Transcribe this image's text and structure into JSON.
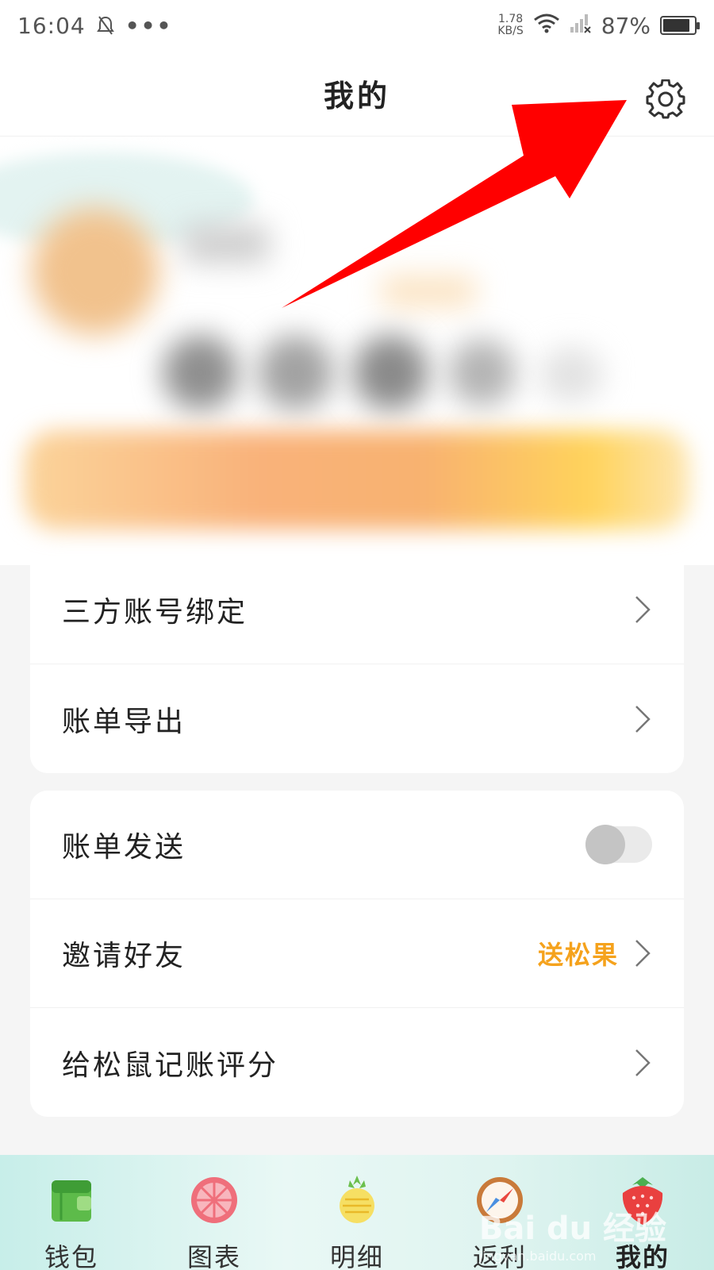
{
  "status_bar": {
    "time": "16:04",
    "dots": "•••",
    "speed_value": "1.78",
    "speed_unit": "KB/S",
    "battery_percent": "87%",
    "battery_level": 0.87
  },
  "header": {
    "title": "我的"
  },
  "menu_card1": {
    "items": [
      {
        "label": "三方账号绑定"
      },
      {
        "label": "账单导出"
      }
    ]
  },
  "menu_card2": {
    "bill_send": {
      "label": "账单发送",
      "toggle_on": false
    },
    "invite": {
      "label": "邀请好友",
      "extra": "送松果"
    },
    "rate": {
      "label": "给松鼠记账评分"
    }
  },
  "tabbar": {
    "tabs": [
      {
        "label": "钱包",
        "icon": "wallet-icon"
      },
      {
        "label": "图表",
        "icon": "chart-icon"
      },
      {
        "label": "明细",
        "icon": "pineapple-icon"
      },
      {
        "label": "返利",
        "icon": "compass-icon"
      },
      {
        "label": "我的",
        "icon": "strawberry-icon",
        "active": true
      }
    ]
  },
  "watermark": {
    "brand": "Bai du 经验",
    "site": "jingyan.baidu.com"
  },
  "colors": {
    "accent": "#f5a21c",
    "arrow": "#ff0000",
    "tabbar_bg": "#dff4f0"
  }
}
